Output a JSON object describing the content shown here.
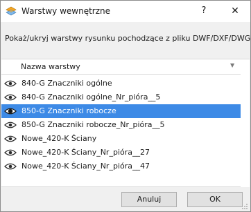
{
  "window": {
    "title": "Warstwy wewnętrzne",
    "help_label": "?",
    "close_label": "✕"
  },
  "description": "Pokaż/ukryj warstwy rysunku pochodzące z pliku DWF/DXF/DWG",
  "list": {
    "column_header": "Nazwa warstwy",
    "sort_indicator": "▼",
    "rows": [
      {
        "label": "840-G Znaczniki ogólne",
        "icon": "eye-icon",
        "selected": false
      },
      {
        "label": "840-G Znaczniki ogólne_Nr_pióra__5",
        "icon": "eye-icon",
        "selected": false
      },
      {
        "label": "850-G Znaczniki robocze",
        "icon": "eye-icon",
        "selected": true
      },
      {
        "label": "850-G Znaczniki robocze_Nr_pióra__5",
        "icon": "eye-icon",
        "selected": false
      },
      {
        "label": "Nowe_420-K Ściany",
        "icon": "eye-icon",
        "selected": false
      },
      {
        "label": "Nowe_420-K Ściany_Nr_pióra__27",
        "icon": "eye-icon",
        "selected": false
      },
      {
        "label": "Nowe_420-K Ściany_Nr_pióra__47",
        "icon": "eye-icon",
        "selected": false
      }
    ]
  },
  "buttons": {
    "cancel_label": "Anuluj",
    "ok_label": "OK"
  },
  "colors": {
    "selection": "#3d8ae6",
    "dialog_background": "#f0f0f0"
  }
}
